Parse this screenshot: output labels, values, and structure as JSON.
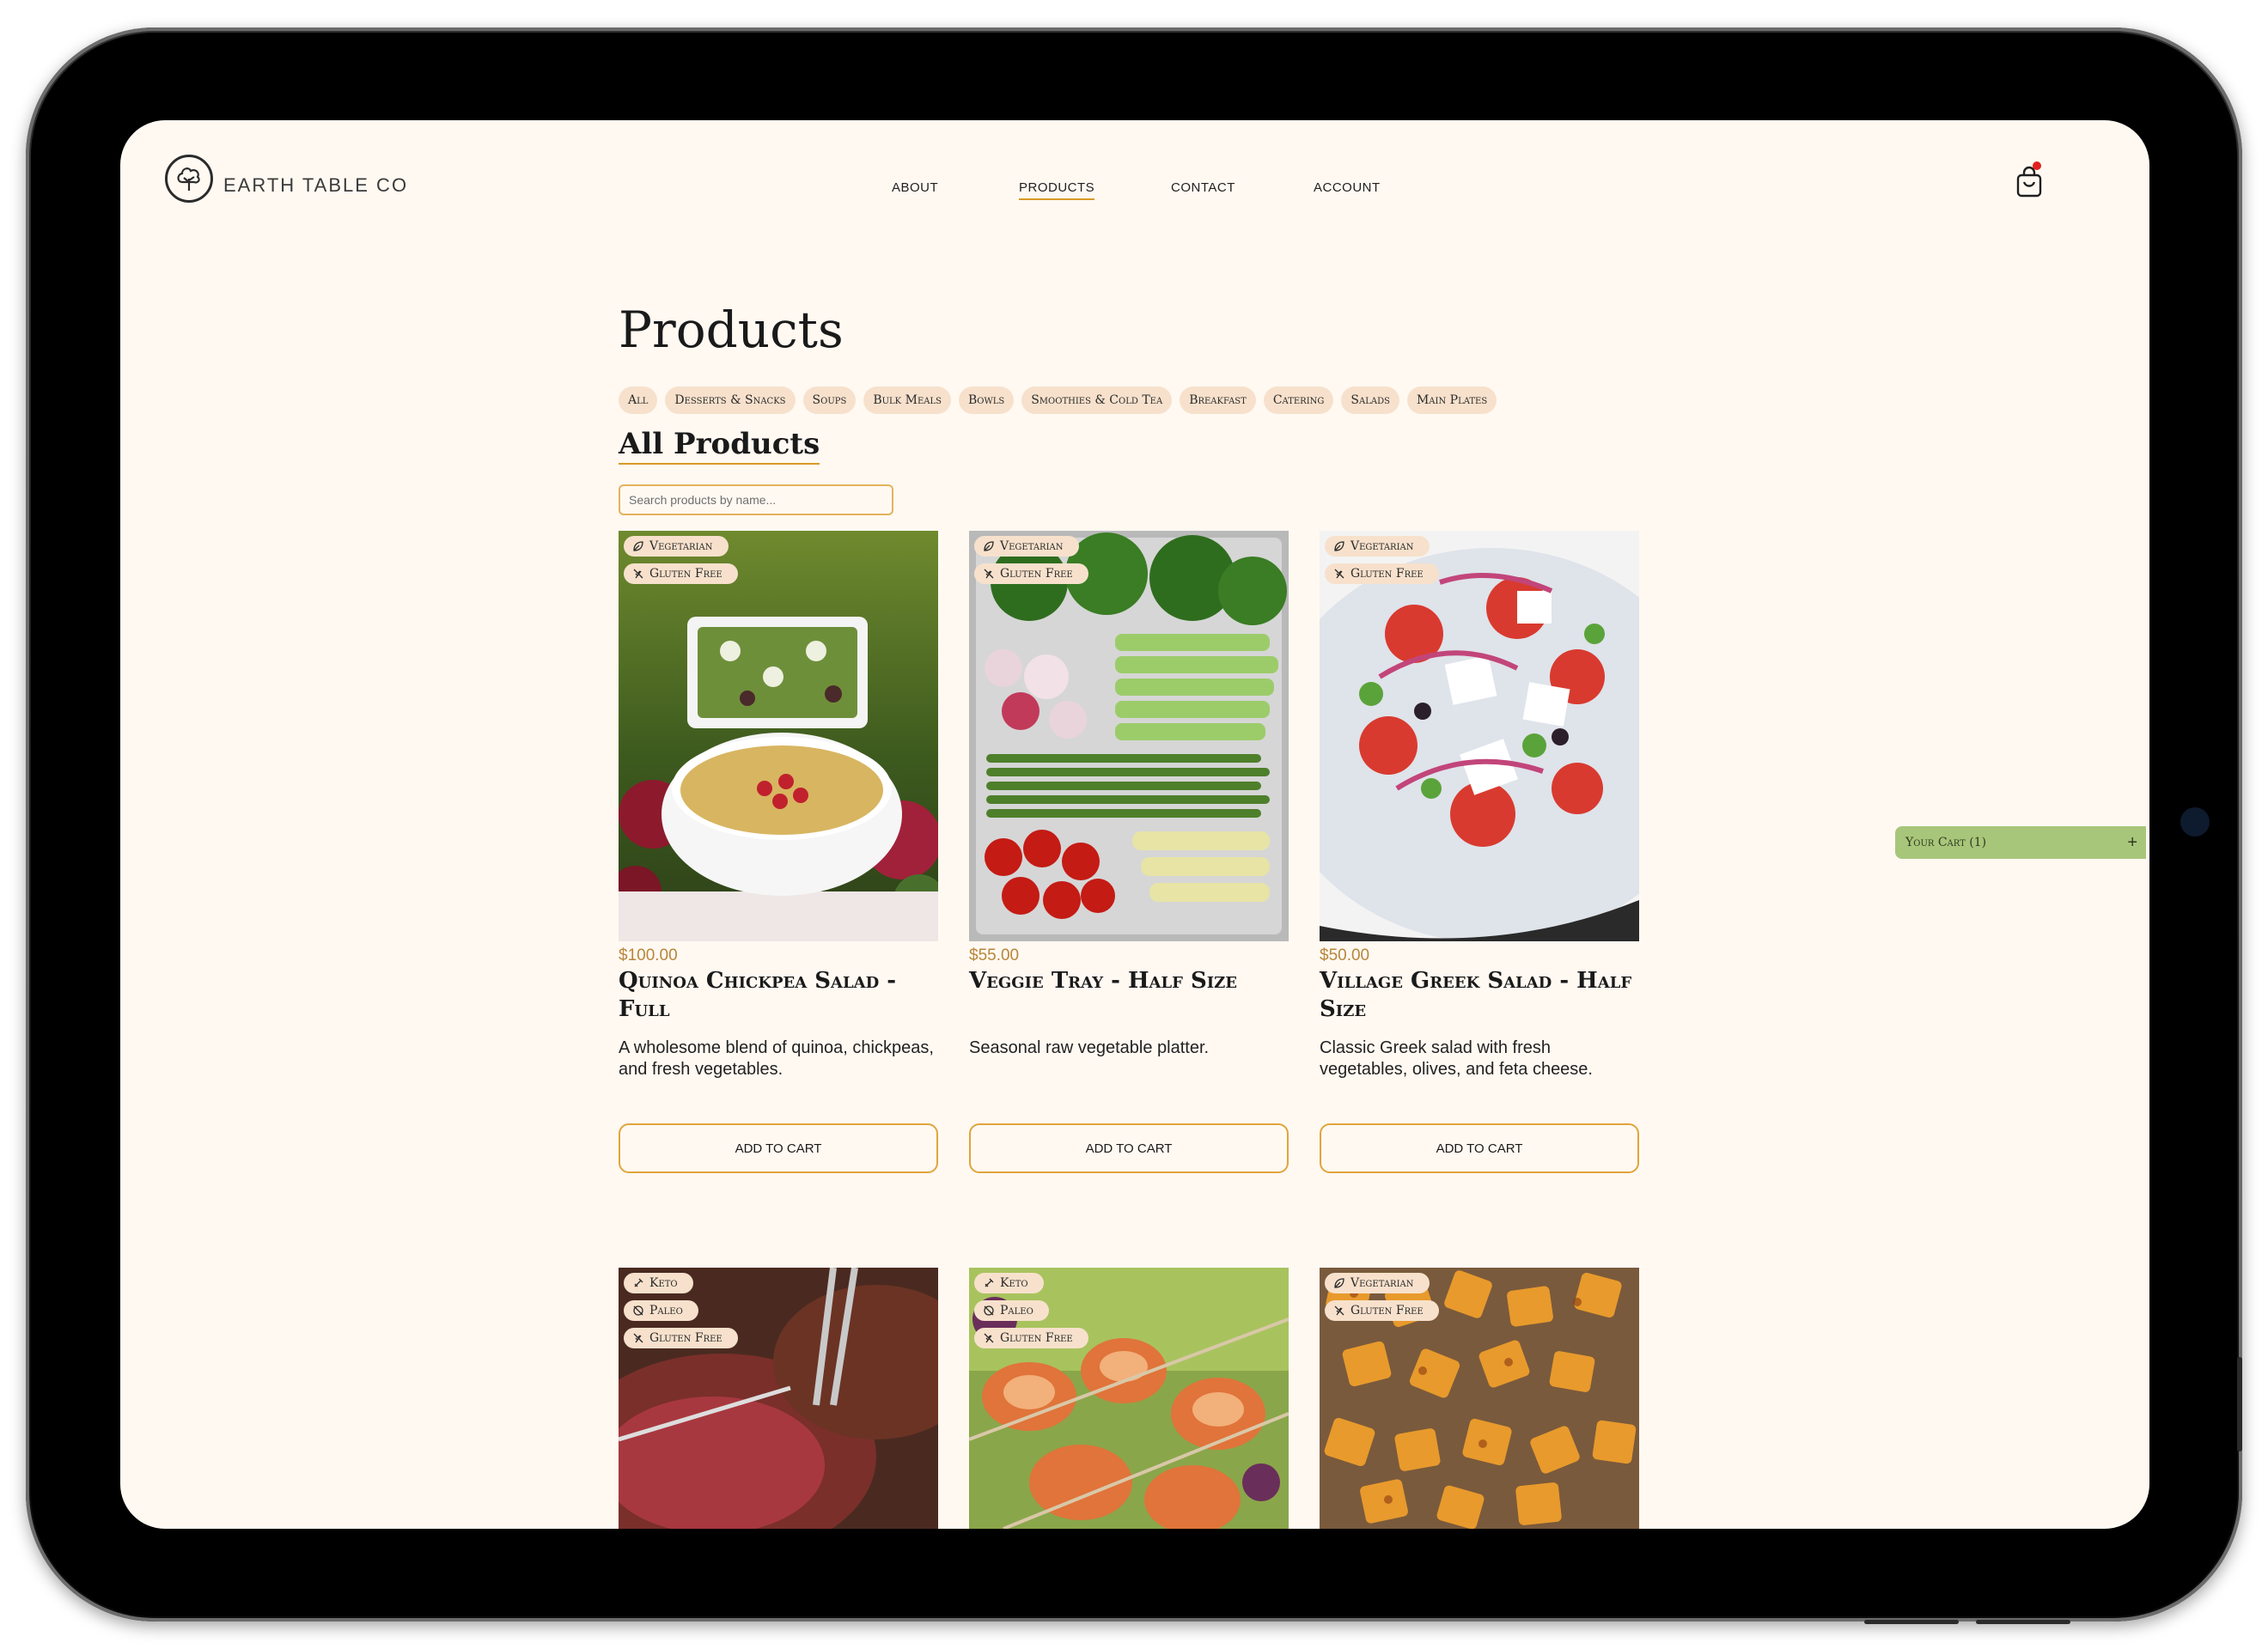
{
  "brand": {
    "name": "EARTH TABLE CO",
    "logo_icon": "tree-icon"
  },
  "nav": {
    "items": [
      {
        "label": "ABOUT",
        "active": false
      },
      {
        "label": "PRODUCTS",
        "active": true
      },
      {
        "label": "CONTACT",
        "active": false
      },
      {
        "label": "ACCOUNT",
        "active": false
      }
    ]
  },
  "cart": {
    "icon": "shopping-bag-icon",
    "has_notification": true,
    "float_label": "Your Cart (1)",
    "float_action": "+"
  },
  "page": {
    "title": "Products",
    "section_title": "All Products"
  },
  "categories": [
    "All",
    "Desserts & Snacks",
    "Soups",
    "Bulk Meals",
    "Bowls",
    "Smoothies & Cold Tea",
    "Breakfast",
    "Catering",
    "Salads",
    "Main Plates"
  ],
  "search": {
    "placeholder": "Search products by name...",
    "value": ""
  },
  "products": [
    {
      "price": "$100.00",
      "name": "Quinoa Chickpea Salad - Full",
      "description": "A wholesome blend of quinoa, chickpeas, and fresh vegetables.",
      "tags": [
        "Vegetarian",
        "Gluten Free"
      ],
      "button": "ADD TO CART"
    },
    {
      "price": "$55.00",
      "name": "Veggie Tray - Half Size",
      "description": "Seasonal raw vegetable platter.",
      "tags": [
        "Vegetarian",
        "Gluten Free"
      ],
      "button": "ADD TO CART"
    },
    {
      "price": "$50.00",
      "name": "Village Greek Salad - Half Size",
      "description": "Classic Greek salad with fresh vegetables, olives, and feta cheese.",
      "tags": [
        "Vegetarian",
        "Gluten Free"
      ],
      "button": "ADD TO CART"
    },
    {
      "tags": [
        "Keto",
        "Paleo",
        "Gluten Free"
      ]
    },
    {
      "tags": [
        "Keto",
        "Paleo",
        "Gluten Free"
      ]
    },
    {
      "tags": [
        "Vegetarian",
        "Gluten Free"
      ]
    }
  ],
  "colors": {
    "background": "#fff9f2",
    "accent": "#d99a26",
    "chip": "#f7e1cc",
    "price": "#b8863a",
    "float_cart": "#a8c67a"
  }
}
